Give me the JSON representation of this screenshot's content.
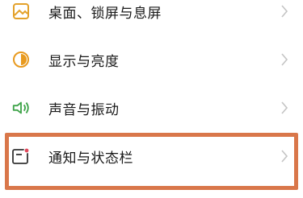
{
  "settings": {
    "items": [
      {
        "label": "桌面、锁屏与息屏",
        "icon": "wallpaper-icon",
        "icon_color": "#e3a12a"
      },
      {
        "label": "显示与亮度",
        "icon": "brightness-icon",
        "icon_color": "#e89a1f"
      },
      {
        "label": "声音与振动",
        "icon": "speaker-icon",
        "icon_color": "#3fa44a"
      },
      {
        "label": "通知与状态栏",
        "icon": "notification-icon",
        "icon_color": "#e0495c"
      }
    ],
    "highlight_color": "#d9774a"
  }
}
